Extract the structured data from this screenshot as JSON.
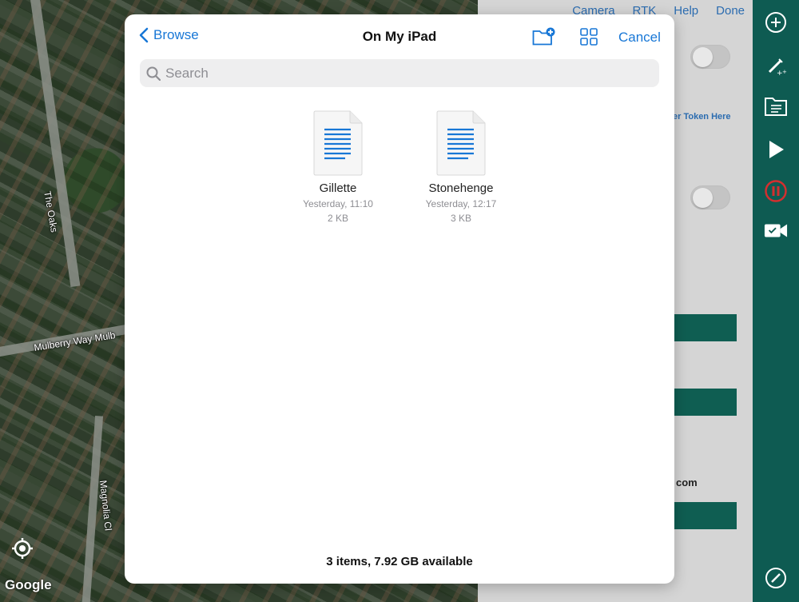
{
  "map": {
    "labels": {
      "the_oaks": "The Oaks",
      "mulberry": "Mulberry Way  Mulb",
      "magnolia": "Magnolia Cl"
    },
    "logo": "Google"
  },
  "settings": {
    "top_links": [
      "Camera",
      "RTK",
      "Help",
      "Done"
    ],
    "token_link": "er Token Here",
    "suffix_text": "com"
  },
  "toolbar": {
    "icons": [
      "add-circle-icon",
      "magic-pen-icon",
      "folder-document-icon",
      "play-icon",
      "pause-record-icon",
      "video-camera-icon",
      "compass-icon"
    ],
    "accent": "#0e5b52",
    "record_color": "#d32f2f"
  },
  "picker": {
    "back_label": "Browse",
    "title": "On My iPad",
    "cancel_label": "Cancel",
    "search_placeholder": "Search",
    "files": [
      {
        "name": "Gillette",
        "date": "Yesterday, 11:10",
        "size": "2 KB"
      },
      {
        "name": "Stonehenge",
        "date": "Yesterday, 12:17",
        "size": "3 KB"
      }
    ],
    "footer": "3 items, 7.92 GB available",
    "accent": "#1877d6"
  }
}
